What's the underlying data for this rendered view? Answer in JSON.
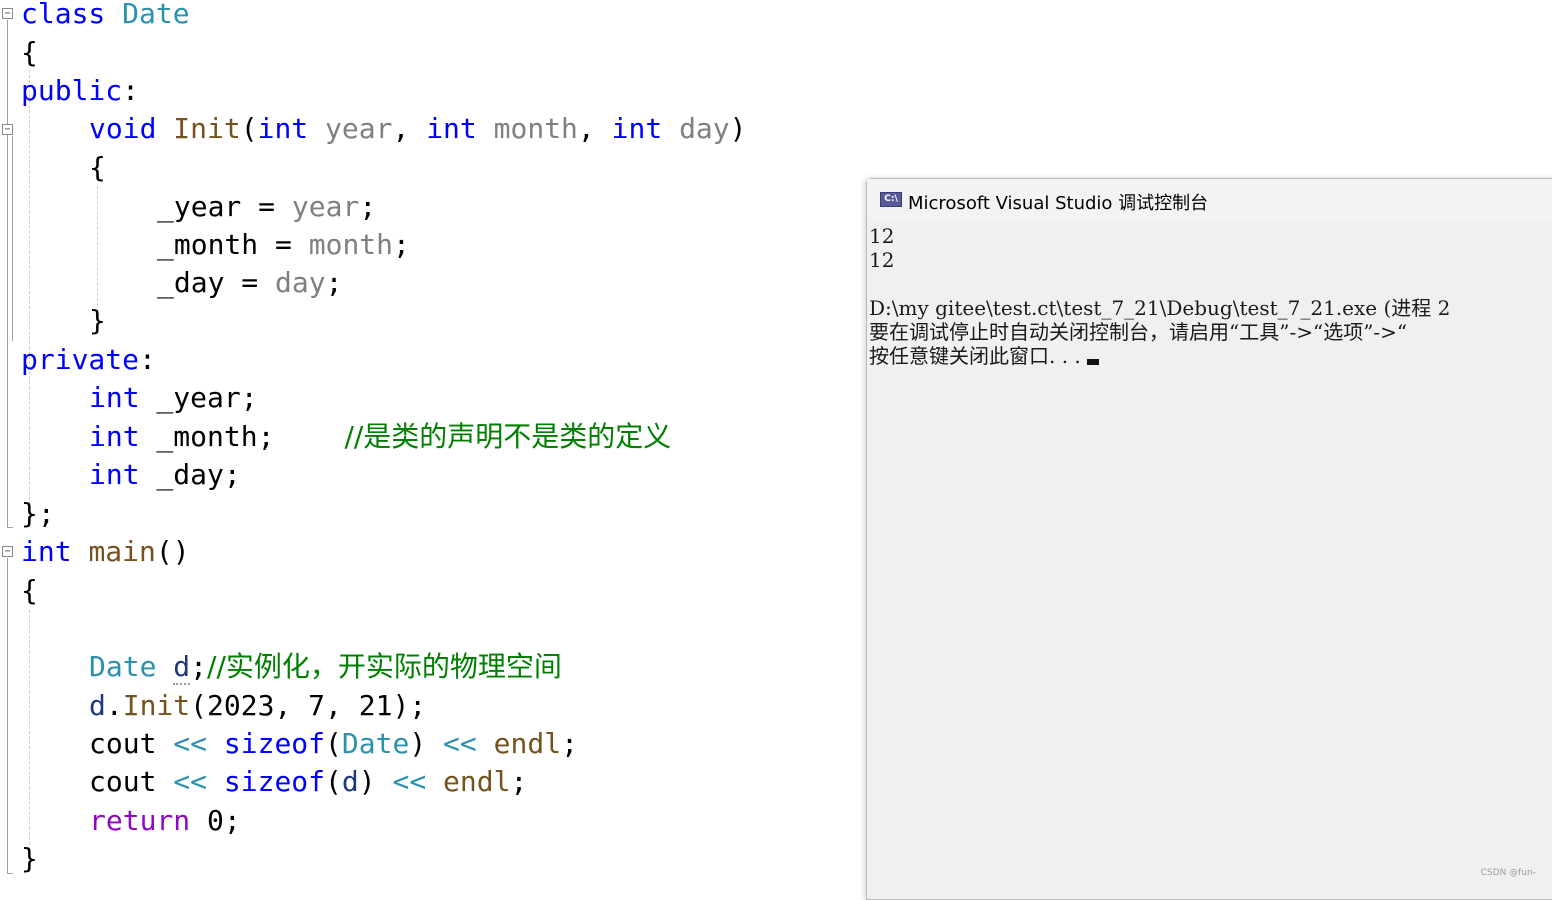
{
  "editor": {
    "l1": {
      "kw": "class",
      "type": "Date"
    },
    "l2": {
      "brace": "{"
    },
    "l3": {
      "kw": "public",
      "colon": ":"
    },
    "l4": {
      "kw1": "void",
      "fn": "Init",
      "open": "(",
      "kw2": "int",
      "p1": "year",
      "comma1": ",",
      "kw3": "int",
      "p2": "month",
      "comma2": ",",
      "kw4": "int",
      "p3": "day",
      "close": ")"
    },
    "l5": {
      "brace": "{"
    },
    "l6": {
      "lhs": "_year",
      "op": " = ",
      "rhs": "year",
      "semi": ";"
    },
    "l7": {
      "lhs": "_month",
      "op": " = ",
      "rhs": "month",
      "semi": ";"
    },
    "l8": {
      "lhs": "_day",
      "op": " = ",
      "rhs": "day",
      "semi": ";"
    },
    "l9": {
      "brace": "}"
    },
    "l10": {
      "kw": "private",
      "colon": ":"
    },
    "l11": {
      "kw": "int",
      "rest": " _year;"
    },
    "l12": {
      "kw": "int",
      "rest": " _month;",
      "comment": "//是类的声明不是类的定义"
    },
    "l13": {
      "kw": "int",
      "rest": " _day;"
    },
    "l14": {
      "text": "};"
    },
    "l15": {
      "kw": "int",
      "fn": "main",
      "parens": "()"
    },
    "l16": {
      "brace": "{"
    },
    "l17": {
      "type": "Date",
      "var": "d",
      "semi": ";",
      "comment": "//实例化，开实际的物理空间"
    },
    "l18": {
      "var": "d",
      "dot": ".",
      "fn": "Init",
      "args": "(2023, 7, 21);"
    },
    "l19": {
      "cout": "cout",
      "op1": " << ",
      "kw": "sizeof",
      "open": "(",
      "type": "Date",
      "close": ")",
      "op2": " << ",
      "endl": "endl",
      "semi": ";"
    },
    "l20": {
      "cout": "cout",
      "op1": " << ",
      "kw": "sizeof",
      "open": "(",
      "var": "d",
      "close": ")",
      "op2": " << ",
      "endl": "endl",
      "semi": ";"
    },
    "l21": {
      "kw": "return",
      "num": " 0",
      "semi": ";"
    },
    "l22": {
      "brace": "}"
    }
  },
  "console": {
    "title": "Microsoft Visual Studio 调试控制台",
    "icon_label": "C:\\",
    "lines": [
      "12",
      "12",
      "",
      "D:\\my gitee\\test.ct\\test_7_21\\Debug\\test_7_21.exe (进程 2",
      "要在调试停止时自动关闭控制台，请启用“工具”->“选项”->“",
      "按任意键关闭此窗口. . ."
    ]
  },
  "watermark": "CSDN @fun-"
}
